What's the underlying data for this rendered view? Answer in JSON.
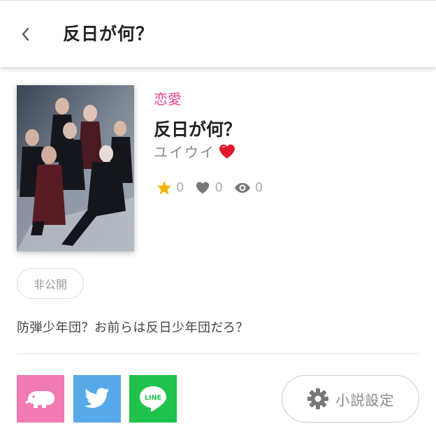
{
  "header": {
    "title": "反日が何？"
  },
  "novel": {
    "genre": "恋愛",
    "title": "反日が何？",
    "author": "ユイウイ",
    "stats": {
      "stars": "0",
      "likes": "0",
      "views": "0"
    },
    "privacy": "非公開",
    "description": "防弾少年団？お前らは反日少年団だろ？"
  },
  "actions": {
    "settings_label": "小説設定"
  },
  "colors": {
    "genre": "#e8458b",
    "star": "#f4b400",
    "app_share": "#f07ab1",
    "twitter": "#58a9ea",
    "line": "#1fc24a"
  }
}
